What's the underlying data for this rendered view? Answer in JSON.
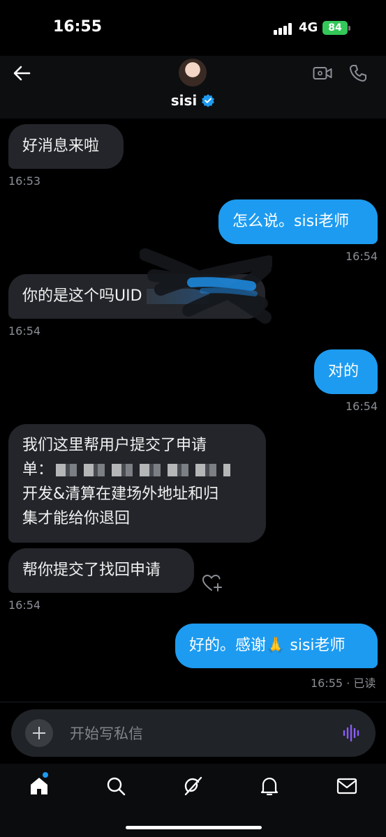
{
  "status_bar": {
    "time": "16:55",
    "network": "4G",
    "battery": "84"
  },
  "header": {
    "contact_name": "sisi"
  },
  "messages": [
    {
      "side": "in",
      "text": "好消息来啦",
      "time": "16:53"
    },
    {
      "side": "out",
      "text": "怎么说。sisi老师",
      "time": "16:54"
    },
    {
      "side": "in",
      "text": "你的是这个吗UID",
      "time": "16:54"
    },
    {
      "side": "out",
      "text": "对的",
      "time": "16:54"
    },
    {
      "side": "in",
      "line1": "我们这里帮用户提交了申请",
      "line2_prefix": "单：",
      "line3": "开发&清算在建场外地址和归",
      "line4": "集才能给你退回"
    },
    {
      "side": "in",
      "text": "帮你提交了找回申请",
      "time": "16:54"
    },
    {
      "side": "out",
      "text": "好的。感谢🙏 sisi老师",
      "time": "16:55 · 已读"
    }
  ],
  "composer": {
    "placeholder": "开始写私信"
  },
  "icons": {
    "back": "back-arrow-icon",
    "verified": "verified-badge-icon",
    "video": "video-camera-icon",
    "phone": "phone-icon",
    "reaction": "heart-plus-icon",
    "add": "plus-icon",
    "voice": "voice-waveform-icon",
    "nav": [
      "home-icon",
      "search-icon",
      "grok-icon",
      "bell-icon",
      "mail-icon"
    ]
  },
  "colors": {
    "accent": "#1d9bf0",
    "incoming": "#23252a",
    "battery": "#34c759",
    "voice": "#8b5cf6"
  }
}
